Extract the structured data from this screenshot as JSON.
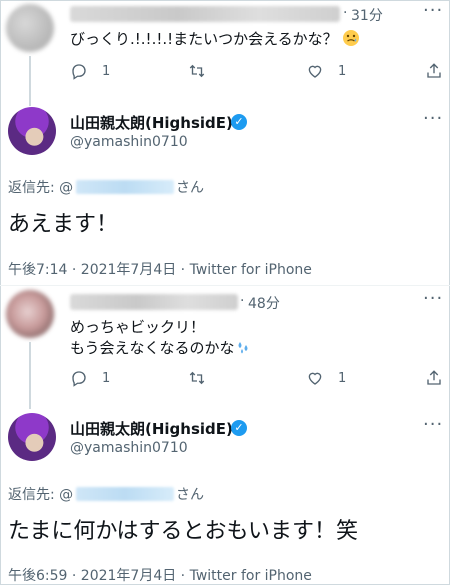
{
  "reply1": {
    "time": "31分",
    "text": "びっくり.!.!.!.!またいつか会えるかな？",
    "reply_count": "1",
    "like_count": "1"
  },
  "main1": {
    "display_name": "山田親太朗(HighsidE)",
    "handle": "@yamashin0710",
    "replying_label": "返信先: @",
    "replying_suffix": "さん",
    "text": "あえます！",
    "timestamp": "午後7:14 · 2021年7月4日 · Twitter for iPhone"
  },
  "reply2": {
    "time": "48分",
    "line1": "めっちゃビックリ！",
    "line2": "もう会えなくなるのかな",
    "reply_count": "1",
    "like_count": "1"
  },
  "main2": {
    "display_name": "山田親太朗(HighsidE)",
    "handle": "@yamashin0710",
    "replying_label": "返信先: @",
    "replying_suffix": "さん",
    "text": "たまに何かはするとおもいます！笑",
    "timestamp": "午後6:59 · 2021年7月4日 · Twitter for iPhone"
  },
  "icons": {
    "more": "more-icon",
    "reply": "reply-icon",
    "retweet": "retweet-icon",
    "like": "like-icon",
    "share": "share-icon",
    "verified": "verified-badge-icon",
    "emoji": "emoji-icon"
  },
  "colors": {
    "accent": "#1d9bf0",
    "text": "#0f1419",
    "muted": "#536471",
    "line": "#cfd9de"
  }
}
